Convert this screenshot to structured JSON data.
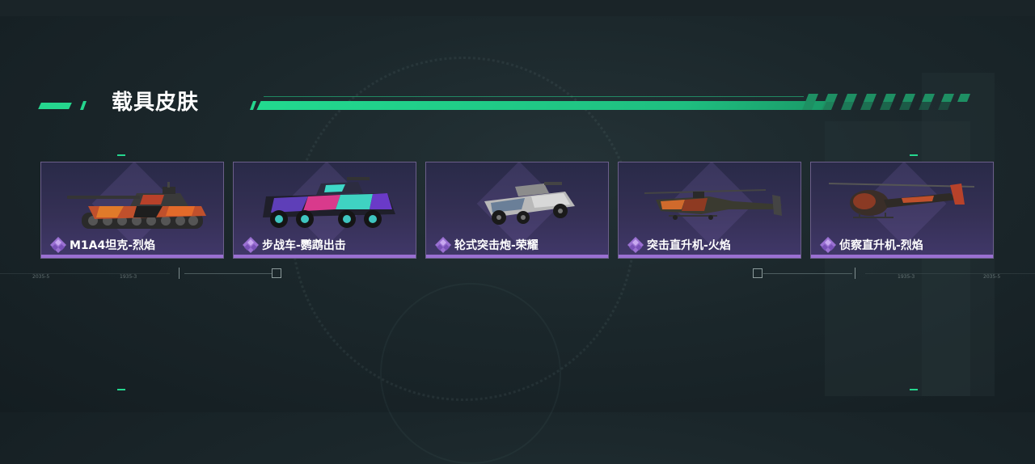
{
  "header": {
    "title": "载具皮肤"
  },
  "cards": [
    {
      "name": "M1A4坦克-烈焰",
      "vehicle_icon": "tank-icon",
      "rarity_icon": "purple-diamond-icon"
    },
    {
      "name": "步战车-鹦鹉出击",
      "vehicle_icon": "ifv-icon",
      "rarity_icon": "purple-diamond-icon"
    },
    {
      "name": "轮式突击炮-荣耀",
      "vehicle_icon": "armored-car-icon",
      "rarity_icon": "purple-diamond-icon"
    },
    {
      "name": "突击直升机-火焰",
      "vehicle_icon": "attack-helicopter-icon",
      "rarity_icon": "purple-diamond-icon"
    },
    {
      "name": "侦察直升机-烈焰",
      "vehicle_icon": "scout-helicopter-icon",
      "rarity_icon": "purple-diamond-icon"
    }
  ],
  "hud": {
    "left_labels": [
      "2035-5",
      "1935-3"
    ],
    "right_labels": [
      "1935-3",
      "2035-5"
    ]
  },
  "colors": {
    "accent_green": "#25d68e",
    "card_border": "#6b5e8a",
    "rarity_purple": "#9a70d2"
  }
}
